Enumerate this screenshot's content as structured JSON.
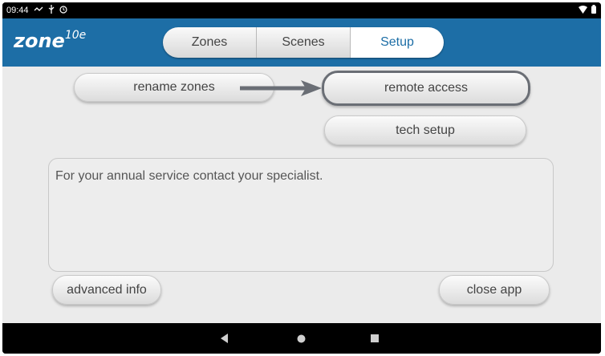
{
  "status_bar": {
    "time": "09:44",
    "icons_left": [
      "missed-call-icon",
      "usb-icon",
      "alarm-icon"
    ],
    "icons_right": [
      "wifi-icon",
      "battery-icon"
    ]
  },
  "app": {
    "brand": "zone",
    "brand_sup": "10e"
  },
  "tabs": [
    {
      "label": "Zones",
      "active": false
    },
    {
      "label": "Scenes",
      "active": false
    },
    {
      "label": "Setup",
      "active": true
    }
  ],
  "buttons": {
    "rename_zones": "rename zones",
    "remote_access": "remote access",
    "tech_setup": "tech setup",
    "advanced_info": "advanced info",
    "close_app": "close app"
  },
  "info": {
    "message": "For your annual service contact your specialist."
  },
  "colors": {
    "accent": "#1d6ea6",
    "background": "#ebebeb",
    "highlight_border": "#6a6e75"
  }
}
